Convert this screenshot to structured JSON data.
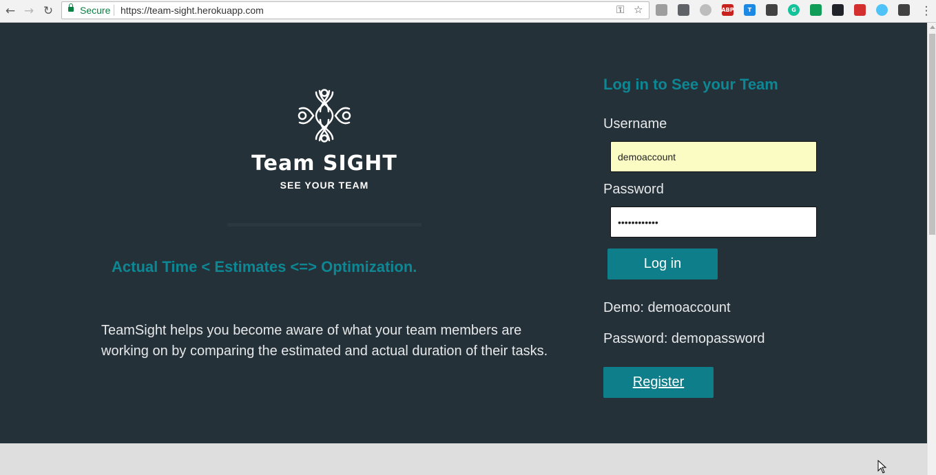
{
  "browser": {
    "secure_label": "Secure",
    "url": "https://team-sight.herokuapp.com",
    "extensions": [
      {
        "name": "camera-icon",
        "color": "#9e9e9e"
      },
      {
        "name": "cast-icon",
        "color": "#5f6368"
      },
      {
        "name": "circle-extension-icon",
        "color": "#bdbdbd"
      },
      {
        "name": "adblock-plus-icon",
        "color": "#c7221f",
        "text": "ABP"
      },
      {
        "name": "t-extension-icon",
        "color": "#1e88e5",
        "text": "T"
      },
      {
        "name": "pocket-icon",
        "color": "#424242"
      },
      {
        "name": "grammarly-icon",
        "color": "#15c39a",
        "text": "G"
      },
      {
        "name": "chat-bubble-icon",
        "color": "#0f9d58"
      },
      {
        "name": "react-devtools-icon",
        "color": "#20232a"
      },
      {
        "name": "vue-extension-icon",
        "color": "#d32f2f"
      },
      {
        "name": "target-extension-icon",
        "color": "#4fc3f7"
      },
      {
        "name": "evernote-icon",
        "color": "#424242"
      }
    ]
  },
  "hero": {
    "brand_name": "Team SIGHT",
    "brand_tagline": "SEE YOUR TEAM",
    "tagline": "Actual Time < Estimates <=> Optimization.",
    "description": "TeamSight helps you become aware of what your team members are working on by comparing the estimated and actual duration of their tasks."
  },
  "login": {
    "title": "Log in to See your Team",
    "username_label": "Username",
    "username_value": "demoaccount",
    "password_label": "Password",
    "password_value": "demopassword",
    "submit_label": "Log in",
    "demo_username_text": "Demo: demoaccount",
    "demo_password_text": "Password: demopassword",
    "register_label": "Register"
  },
  "colors": {
    "page_background": "#253139",
    "accent": "#0e8794",
    "button": "#0e7f8a",
    "autofill": "#fafcc4"
  }
}
